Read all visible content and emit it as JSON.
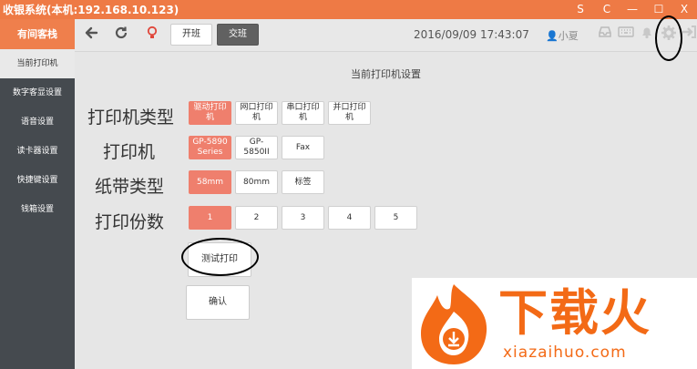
{
  "window": {
    "title": "收银系统(本机:192.168.10.123)",
    "controls": [
      "S",
      "C",
      "—",
      "☐",
      "X"
    ]
  },
  "sidebar": {
    "store_name": "有间客栈",
    "items": [
      {
        "label": "当前打印机",
        "active": true
      },
      {
        "label": "数字客显设置",
        "active": false
      },
      {
        "label": "语音设置",
        "active": false
      },
      {
        "label": "读卡器设置",
        "active": false
      },
      {
        "label": "快捷键设置",
        "active": false
      },
      {
        "label": "钱箱设置",
        "active": false
      }
    ]
  },
  "header": {
    "back_icon": "arrow-left-icon",
    "refresh_icon": "refresh-icon",
    "bulb_icon": "lightbulb-icon",
    "open_shift_label": "开班",
    "handover_label": "交班",
    "datetime": "2016/09/09 17:43:07",
    "user_name": "小夏",
    "right_icons": [
      "tray-icon",
      "keyboard-icon",
      "bell-icon",
      "gear-icon",
      "logout-icon"
    ]
  },
  "settings": {
    "title": "当前打印机设置",
    "printer_type": {
      "label": "打印机类型",
      "options": [
        "驱动打印机",
        "网口打印机",
        "串口打印机",
        "并口打印机"
      ],
      "selected": 0
    },
    "printer": {
      "label": "打印机",
      "options": [
        "GP-5890 Series",
        "GP-5850II",
        "Fax"
      ],
      "selected": 0
    },
    "paper_type": {
      "label": "纸带类型",
      "options": [
        "58mm",
        "80mm",
        "标签"
      ],
      "selected": 0
    },
    "copies": {
      "label": "打印份数",
      "options": [
        "1",
        "2",
        "3",
        "4",
        "5"
      ],
      "selected": 0
    },
    "test_print_label": "测试打印",
    "confirm_label": "确认"
  },
  "watermark": {
    "text": "下载火",
    "subtext": "xiazaihuo.com"
  },
  "colors": {
    "accent": "#ee7a45",
    "selected": "#ef7f6d",
    "sidebar_bg": "#454a4f",
    "watermark": "#f36a16"
  }
}
